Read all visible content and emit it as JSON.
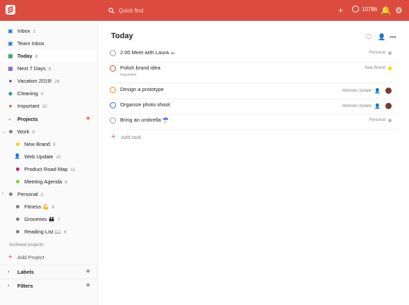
{
  "colors": {
    "brand": "#db4c3f",
    "inbox": "#246fe0",
    "today": "#058527",
    "next7": "#692fc2"
  },
  "topbar": {
    "search_placeholder": "Quick find",
    "karma": "10786"
  },
  "sidebar": {
    "items": [
      {
        "label": "Inbox",
        "count": "2"
      },
      {
        "label": "Team Inbox",
        "count": ""
      },
      {
        "label": "Today",
        "count": "8"
      },
      {
        "label": "Next 7 Days",
        "count": "8"
      },
      {
        "label": "Vacation 2019!",
        "count": "24"
      },
      {
        "label": "Cleaning",
        "count": "4"
      },
      {
        "label": "Important",
        "count": "32"
      }
    ],
    "projects_label": "Projects",
    "projects": [
      {
        "label": "Work",
        "count": "9",
        "color": "#808080"
      },
      {
        "label": "New Brand",
        "count": "9",
        "color": "#fad000"
      },
      {
        "label": "Web Update",
        "count": "10",
        "color": "#4073ff"
      },
      {
        "label": "Product Road Map",
        "count": "11",
        "color": "#b8256f"
      },
      {
        "label": "Meeting Agenda",
        "count": "6",
        "color": "#7ecc49"
      },
      {
        "label": "Personal",
        "count": "2",
        "color": "#808080"
      },
      {
        "label": "Fitness 💪",
        "count": "9",
        "color": "#808080"
      },
      {
        "label": "Groceries 👪",
        "count": "7",
        "color": "#808080"
      },
      {
        "label": "Reading List 📖",
        "count": "6",
        "color": "#808080"
      }
    ],
    "archived": "Archived projects",
    "add_project": "Add Project",
    "labels": "Labels",
    "filters": "Filters"
  },
  "main": {
    "title": "Today",
    "tasks": [
      {
        "name": "2:00 Meet with Laura ☕",
        "sub": "",
        "project": "Personal",
        "pcolor": "#b8b8b8",
        "ring": "#999"
      },
      {
        "name": "Polish brand idea",
        "sub": "Important",
        "project": "New Brand",
        "pcolor": "#fad000",
        "ring": "#d1453b"
      },
      {
        "name": "Design a prototype",
        "sub": "",
        "project": "Website Update",
        "pcolor": "",
        "ring": "#eb8909"
      },
      {
        "name": "Organize photo shoot",
        "sub": "",
        "project": "Website Update",
        "pcolor": "",
        "ring": "#246fe0"
      },
      {
        "name": "Bring an umbrella ☂️",
        "sub": "",
        "project": "Personal",
        "pcolor": "#b8b8b8",
        "ring": "#999"
      }
    ],
    "add_task": "Add task"
  }
}
